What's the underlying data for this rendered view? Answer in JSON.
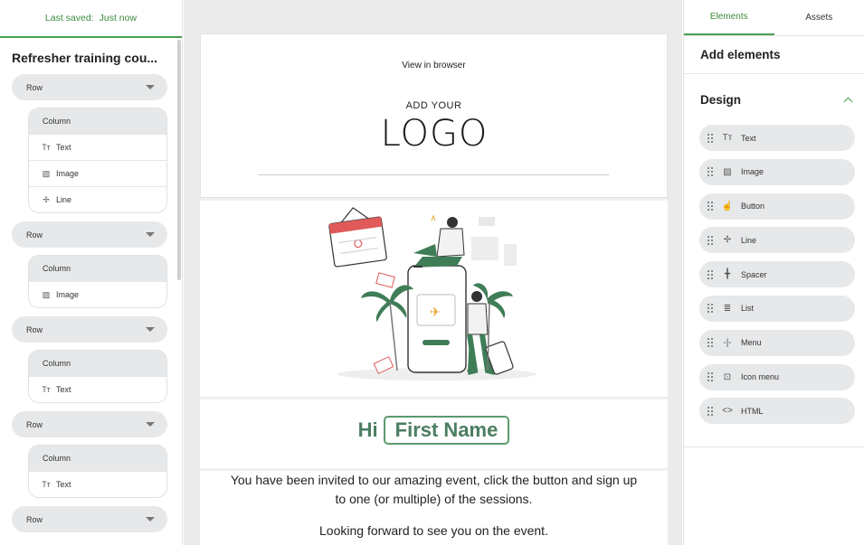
{
  "left_panel": {
    "saved_label": "Last saved:",
    "saved_value": "Just now",
    "document_title": "Refresher training cou...",
    "rows": [
      {
        "label": "Row",
        "column": "Column",
        "items": [
          {
            "icon": "text-icon",
            "glyph": "Tт",
            "label": "Text"
          },
          {
            "icon": "image-icon",
            "glyph": "▨",
            "label": "Image"
          },
          {
            "icon": "line-icon",
            "glyph": "✢",
            "label": "Line"
          }
        ]
      },
      {
        "label": "Row",
        "column": "Column",
        "items": [
          {
            "icon": "image-icon",
            "glyph": "▨",
            "label": "Image"
          }
        ]
      },
      {
        "label": "Row",
        "column": "Column",
        "items": [
          {
            "icon": "text-icon",
            "glyph": "Tт",
            "label": "Text"
          }
        ]
      },
      {
        "label": "Row",
        "column": "Column",
        "items": [
          {
            "icon": "text-icon",
            "glyph": "Tт",
            "label": "Text"
          }
        ]
      },
      {
        "label": "Row"
      }
    ]
  },
  "email": {
    "view_in_browser": "View in browser",
    "add_your": "ADD YOUR",
    "logo": "LOGO",
    "greeting": "Hi",
    "first_name": "First Name",
    "body_text": "You have been invited to our amazing event, click the button and sign up to one (or multiple) of the sessions.",
    "closing_text": "Looking forward to see you on the event."
  },
  "right_panel": {
    "tabs": [
      {
        "label": "Elements",
        "active": true
      },
      {
        "label": "Assets",
        "active": false
      }
    ],
    "add_elements_heading": "Add elements",
    "design_heading": "Design",
    "elements": [
      {
        "icon": "text-icon",
        "glyph": "Tт",
        "label": "Text"
      },
      {
        "icon": "image-icon",
        "glyph": "▨",
        "label": "Image"
      },
      {
        "icon": "button-icon",
        "glyph": "☝",
        "label": "Button"
      },
      {
        "icon": "line-icon",
        "glyph": "✢",
        "label": "Line"
      },
      {
        "icon": "spacer-icon",
        "glyph": "╋",
        "label": "Spacer"
      },
      {
        "icon": "list-icon",
        "glyph": "≣",
        "label": "List"
      },
      {
        "icon": "menu-icon",
        "glyph": "-|-",
        "label": "Menu"
      },
      {
        "icon": "icon-menu-icon",
        "glyph": "⊡",
        "label": "Icon menu"
      },
      {
        "icon": "html-icon",
        "glyph": "<>",
        "label": "HTML"
      }
    ]
  },
  "colors": {
    "accent": "#4aa04f",
    "greeting": "#4b7d61",
    "pill": "#e6e8ea"
  }
}
